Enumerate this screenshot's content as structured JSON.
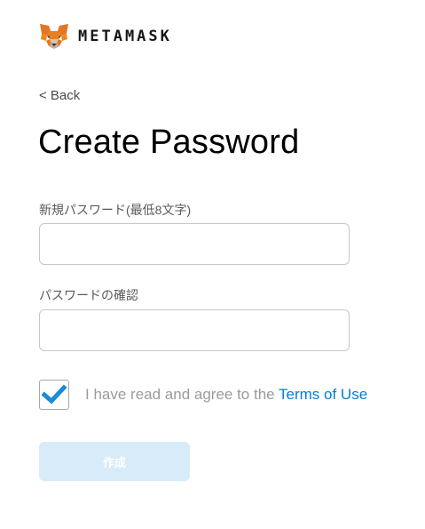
{
  "header": {
    "logo_icon": "metamask-fox-icon",
    "wordmark": "METAMASK"
  },
  "nav": {
    "back_label": "< Back"
  },
  "form": {
    "title": "Create Password",
    "new_password": {
      "label": "新規パスワード(最低8文字)",
      "value": ""
    },
    "confirm_password": {
      "label": "パスワードの確認",
      "value": ""
    },
    "terms": {
      "checked": true,
      "check_icon": "checkmark-icon",
      "text": "I have read and agree to the ",
      "link_text": "Terms of Use"
    },
    "create_button_label": "作成"
  },
  "colors": {
    "link": "#037dd6",
    "button_disabled_bg": "#d7ebf8",
    "checkmark": "#1a8cd8"
  }
}
